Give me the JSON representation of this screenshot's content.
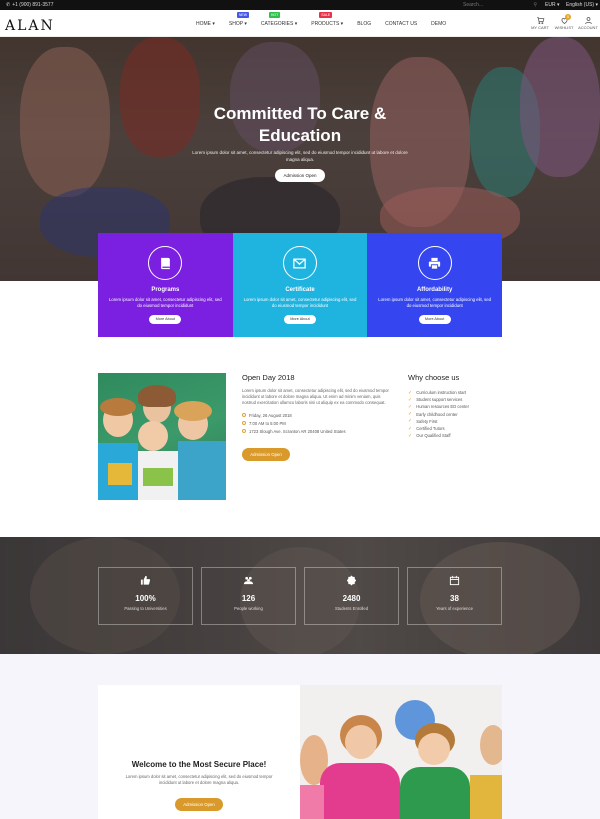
{
  "topbar": {
    "phone": "+1 (900) 891-3577",
    "search_placeholder": "Search...",
    "currency": "EUR",
    "language": "English (US)"
  },
  "header": {
    "logo": "ALAN",
    "nav": [
      {
        "label": "HOME",
        "badge": ""
      },
      {
        "label": "SHOP",
        "badge": "NEW"
      },
      {
        "label": "CATEGORIES",
        "badge": "HOT"
      },
      {
        "label": "PRODUCTS",
        "badge": "SALE"
      },
      {
        "label": "BLOG",
        "badge": ""
      },
      {
        "label": "CONTACT US",
        "badge": ""
      },
      {
        "label": "DEMO",
        "badge": ""
      }
    ],
    "icons": [
      {
        "label": "MY CART",
        "icon": "cart-icon"
      },
      {
        "label": "WISHLIST",
        "icon": "heart-icon",
        "count": "0"
      },
      {
        "label": "ACCOUNT",
        "icon": "user-icon"
      }
    ]
  },
  "hero": {
    "title_line1": "Committed To Care &",
    "title_line2": "Education",
    "text": "Lorem ipsum dolor sit amet, consectetur adipiscing elit, sed do eiusmod tempor incididunt ut labore et dolore magna aliqua.",
    "button": "Admission Open"
  },
  "features": [
    {
      "title": "Programs",
      "text": "Lorem ipsum dolor sit amet, consectetur adipiscing elit, sed do eiusmod tempor incididunt",
      "button": "More About",
      "color": "#7b1fe0",
      "icon": "book-icon"
    },
    {
      "title": "Certificate",
      "text": "Lorem ipsum dolor sit amet, consectetur adipiscing elit, sed do eiusmod tempor incididunt",
      "button": "More About",
      "color": "#1fb3e0",
      "icon": "envelope-icon"
    },
    {
      "title": "Affordability",
      "text": "Lorem ipsum dolor sit amet, consectetur adipiscing elit, sed do eiusmod tempor incididunt",
      "button": "More About",
      "color": "#3546f0",
      "icon": "printer-icon"
    }
  ],
  "openday": {
    "title": "Open Day 2018",
    "text": "Lorem ipsum dolor sit amet, consectetur adipiscing elit, sed do eiusmod tempor incididunt ut labore et dolore magna aliqua. Ut enim ad minim veniam, quis nostrud exercitation ullamco laboris nisi ut aliquip ex ea commodo consequat.",
    "date": "Friday, 26 August 2018",
    "time": "7:00 AM to 5:00 PM",
    "address": "1723 Slough Ave. Scranton AR 20408 United States",
    "button": "Admission Open"
  },
  "why": {
    "title": "Why choose us",
    "items": [
      "Curriculum instruction start",
      "Student support services",
      "Human resources ED center",
      "Early childhood center",
      "Safety First",
      "Certified Tutors",
      "Our Qualified Staff"
    ]
  },
  "stats": [
    {
      "value": "100%",
      "label": "Passing to Universities",
      "icon": "thumbs-up-icon"
    },
    {
      "value": "126",
      "label": "People working",
      "icon": "users-icon"
    },
    {
      "value": "2480",
      "label": "Students Enrolled",
      "icon": "badge-icon"
    },
    {
      "value": "38",
      "label": "Years of experience",
      "icon": "calendar-icon"
    }
  ],
  "welcome": {
    "title": "Welcome to the Most Secure Place!",
    "text": "Lorem ipsum dolor sit amet, consectetur adipiscing elit, sed do eiusmod tempor incididunt ut labore et dolore magna aliqua.",
    "button": "Admission Open"
  }
}
